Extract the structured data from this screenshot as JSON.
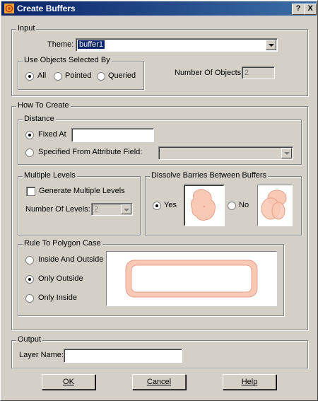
{
  "window": {
    "title": "Create Buffers",
    "help_btn": "?",
    "close_btn": "X"
  },
  "input_group": {
    "legend": "Input",
    "theme_label": "Theme:",
    "theme_value": "buffer1",
    "use_objects_legend": "Use Objects Selected By",
    "options": [
      "All",
      "Pointed",
      "Queried"
    ],
    "selected_option": "All",
    "num_objects_label": "Number Of Objects:",
    "num_objects_value": "2"
  },
  "how_to_create": {
    "legend": "How To Create",
    "distance": {
      "legend": "Distance",
      "fixed_at_label": "Fixed At",
      "fixed_at_value": "",
      "attribute_label": "Specified From Attribute Field:",
      "attribute_value": ""
    },
    "multiple_levels": {
      "legend": "Multiple Levels",
      "generate_label": "Generate Multiple Levels",
      "num_levels_label": "Number Of Levels:",
      "num_levels_value": "2"
    },
    "dissolve": {
      "legend": "Dissolve Barries Between Buffers",
      "yes_label": "Yes",
      "no_label": "No"
    },
    "polygon_rule": {
      "legend": "Rule To Polygon Case",
      "options": [
        "Inside And Outside",
        "Only Outside",
        "Only Inside"
      ],
      "selected_option": "Only Outside"
    }
  },
  "output": {
    "legend": "Output",
    "layer_label": "Layer Name:",
    "layer_value": ""
  },
  "buttons": {
    "ok": "OK",
    "cancel": "Cancel",
    "help": "Help"
  },
  "colors": {
    "titlebar": "#0a246a",
    "buffer_fill": "#f9c9b5",
    "buffer_stroke": "#e8a08a"
  }
}
